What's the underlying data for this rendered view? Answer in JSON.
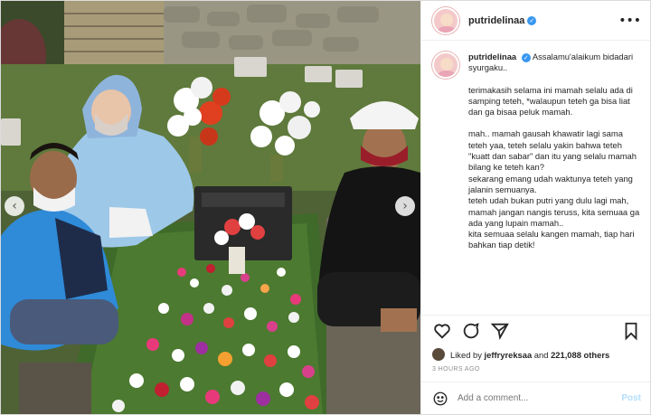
{
  "post": {
    "username": "putridelinaa",
    "verified": true,
    "more_icon": "more-options-icon",
    "caption": {
      "username": "putridelinaa",
      "lines": [
        "Assalamu'alaikum bidadari syurgaku..",
        "terimakasih selama ini mamah selalu ada di samping teteh, *walaupun teteh ga bisa liat dan ga bisaa peluk mamah.",
        "mah.. mamah gausah khawatir lagi sama teteh yaa, teteh selalu yakin bahwa teteh \"kuatt dan sabar\" dan itu yang selalu mamah bilang ke teteh kan?",
        "sekarang emang udah waktunya teteh yang jalanin semuanya.",
        "teteh udah bukan putri yang dulu lagi mah,",
        "mamah jangan nangis teruss, kita semuaa ga ada yang lupain mamah..",
        "kita semuaa selalu kangen mamah, tiap hari bahkan tiap detik!"
      ]
    },
    "likes": {
      "prefix": "Liked by",
      "user": "jeffryreksaa",
      "joiner": "and",
      "count": "221,088 others"
    },
    "time": "3 HOURS AGO",
    "comment": {
      "placeholder": "Add a comment...",
      "post_label": "Post"
    },
    "actions": [
      "heart-icon",
      "comment-icon",
      "share-icon",
      "bookmark-icon"
    ],
    "carousel": {
      "prev": "‹",
      "next": "›"
    }
  },
  "colors": {
    "verified_blue": "#3897f0",
    "post_button": "#b2dffc",
    "muted_text": "#8e8e8e"
  }
}
